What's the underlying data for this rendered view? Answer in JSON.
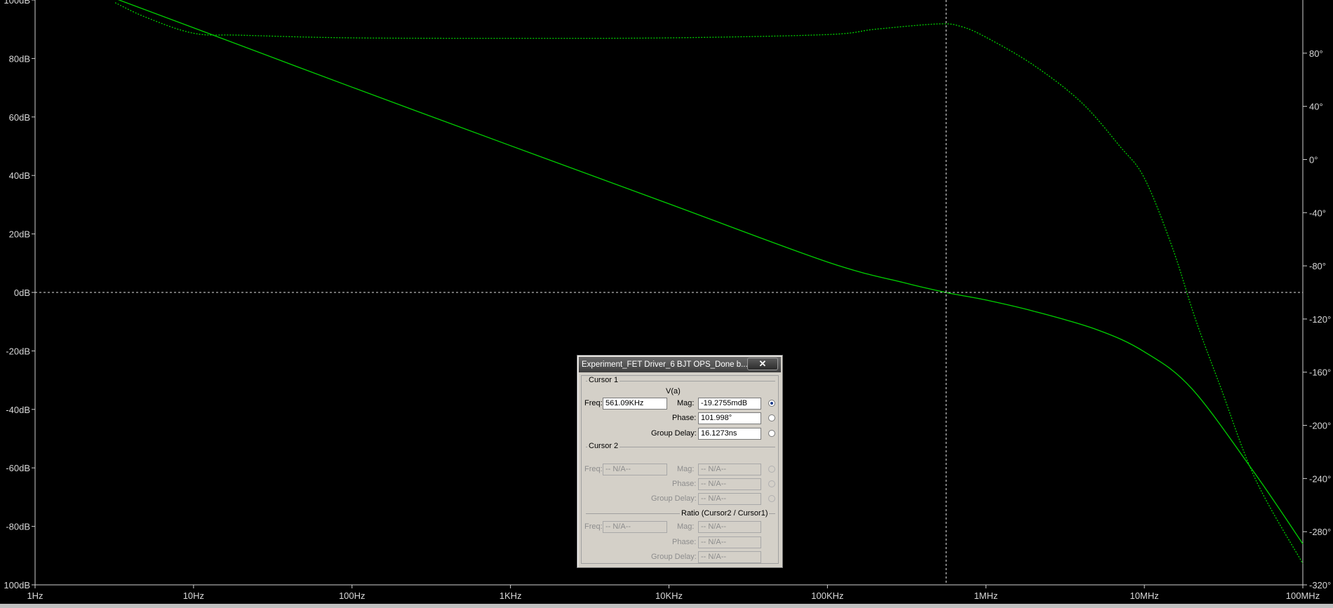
{
  "chart_data": {
    "type": "line",
    "x_scale": "log",
    "xlim": [
      "1Hz",
      "100MHz"
    ],
    "ylim_left": [
      -100,
      100
    ],
    "ylim_right": [
      -320,
      120
    ],
    "grid": false,
    "x_ticks": [
      "1Hz",
      "10Hz",
      "100Hz",
      "1KHz",
      "10KHz",
      "100KHz",
      "1MHz",
      "10MHz",
      "100MHz"
    ],
    "y_left_ticks": [
      "100dB",
      "80dB",
      "60dB",
      "40dB",
      "20dB",
      "0dB",
      "-20dB",
      "-40dB",
      "-60dB",
      "-80dB",
      "100dB"
    ],
    "y_right_ticks": [
      "80°",
      "40°",
      "0°",
      "-40°",
      "-80°",
      "-120°",
      "-160°",
      "-200°",
      "-240°",
      "-280°",
      "-320°"
    ],
    "series": [
      {
        "style": "solid",
        "axis": "left",
        "color": "#00d000",
        "points": [
          [
            3.2,
            100.5
          ],
          [
            10,
            90.5
          ],
          [
            100,
            70.2
          ],
          [
            1000,
            50.2
          ],
          [
            10000,
            30.3
          ],
          [
            100000,
            10.4
          ],
          [
            300000,
            3.4
          ],
          [
            561090,
            -0.02
          ],
          [
            1000000,
            -2.6
          ],
          [
            2000000,
            -6.4
          ],
          [
            5000000,
            -12.7
          ],
          [
            10000000,
            -20.3
          ],
          [
            20000000,
            -33
          ],
          [
            50000000,
            -62
          ],
          [
            100000000,
            -86
          ]
        ]
      },
      {
        "style": "dotted",
        "axis": "right",
        "color": "#00d000",
        "points": [
          [
            3.2,
            118
          ],
          [
            5,
            107
          ],
          [
            10,
            95
          ],
          [
            20,
            93.5
          ],
          [
            100,
            91.5
          ],
          [
            1000,
            91.2
          ],
          [
            10000,
            91.5
          ],
          [
            100000,
            94
          ],
          [
            200000,
            98
          ],
          [
            500000,
            102
          ],
          [
            700000,
            100
          ],
          [
            1000000,
            92
          ],
          [
            2000000,
            71
          ],
          [
            4000000,
            43
          ],
          [
            7000000,
            10
          ],
          [
            10000000,
            -14
          ],
          [
            15000000,
            -66
          ],
          [
            21000000,
            -120
          ],
          [
            30000000,
            -170
          ],
          [
            50000000,
            -240
          ],
          [
            100000000,
            -304
          ]
        ]
      }
    ],
    "cursor": {
      "x": 561090,
      "y": 0
    }
  },
  "dialog": {
    "title": "Experiment_FET Driver_6 BJT OPS_Done b...",
    "close_glyph": "✕",
    "cursor1": {
      "title": "Cursor 1",
      "trace": "V(a)",
      "freq_label": "Freq:",
      "freq": "561.09KHz",
      "mag_label": "Mag:",
      "mag": "-19.2755mdB",
      "phase_label": "Phase:",
      "phase": "101.998°",
      "gd_label": "Group Delay:",
      "gd": "16.1273ns"
    },
    "cursor2": {
      "title": "Cursor 2",
      "freq_label": "Freq:",
      "freq": "-- N/A--",
      "mag_label": "Mag:",
      "mag": "-- N/A--",
      "phase_label": "Phase:",
      "phase": "-- N/A--",
      "gd_label": "Group Delay:",
      "gd": "-- N/A--"
    },
    "ratio": {
      "title": "Ratio (Cursor2 / Cursor1)",
      "freq_label": "Freq:",
      "freq": "-- N/A--",
      "mag_label": "Mag:",
      "mag": "-- N/A--",
      "phase_label": "Phase:",
      "phase": "-- N/A--",
      "gd_label": "Group Delay:",
      "gd": "-- N/A--"
    }
  }
}
